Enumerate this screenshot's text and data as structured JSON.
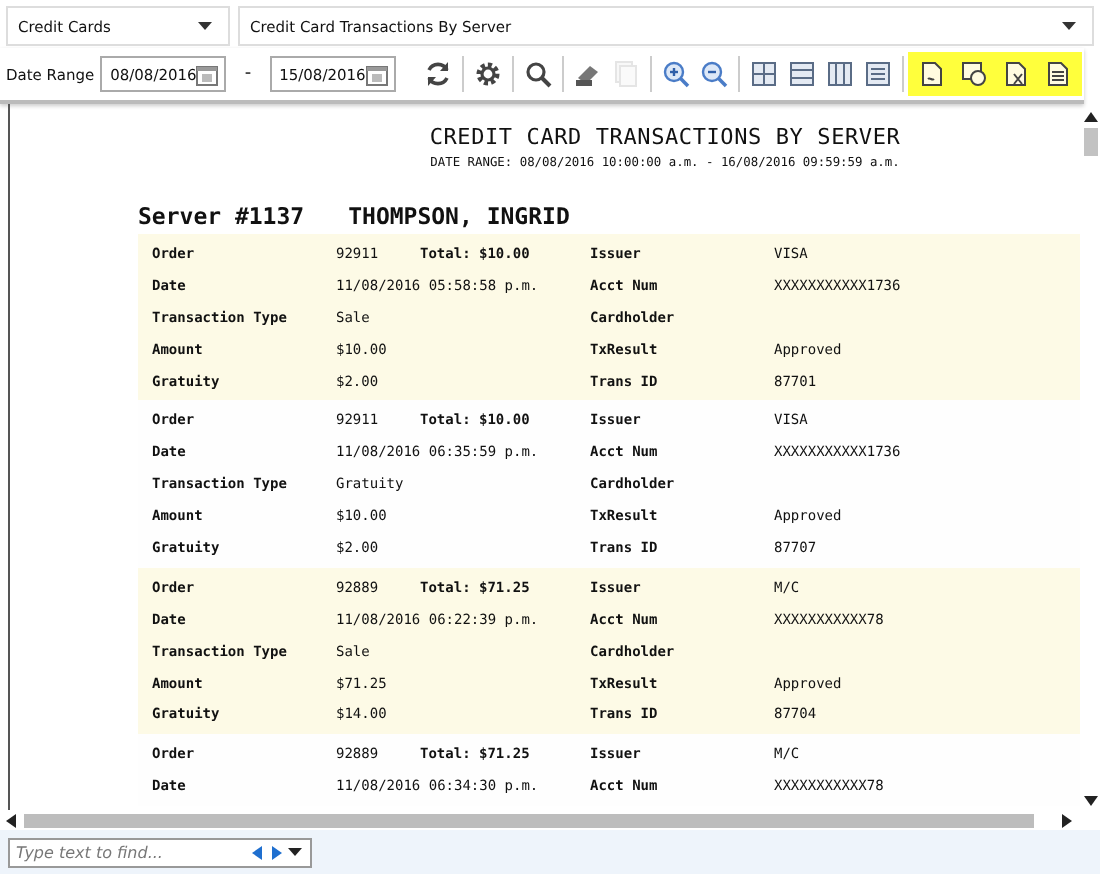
{
  "selectors": [
    {
      "value": "Credit Cards"
    },
    {
      "value": "Credit Card Transactions By Server"
    }
  ],
  "toolbar": {
    "date_range_label": "Date Range",
    "date_from": "08/08/2016",
    "separator": "-",
    "date_to": "15/08/2016",
    "groups": [
      {
        "buttons": [
          {
            "kind": "refresh",
            "disabled": false
          }
        ]
      },
      {
        "buttons": [
          {
            "kind": "settings",
            "disabled": false
          }
        ]
      },
      {
        "buttons": [
          {
            "kind": "find",
            "disabled": false
          }
        ]
      },
      {
        "buttons": [
          {
            "kind": "print",
            "disabled": false
          },
          {
            "kind": "copy",
            "disabled": true
          }
        ]
      },
      {
        "buttons": [
          {
            "kind": "zoom-in",
            "disabled": false
          },
          {
            "kind": "zoom-out",
            "disabled": false
          }
        ]
      },
      {
        "buttons": [
          {
            "kind": "grid",
            "disabled": false
          },
          {
            "kind": "rows",
            "disabled": false
          },
          {
            "kind": "columns",
            "disabled": false
          },
          {
            "kind": "lines",
            "disabled": false
          }
        ]
      }
    ],
    "export_group": {
      "highlighted": true,
      "buttons": [
        {
          "kind": "doc",
          "disabled": false
        },
        {
          "kind": "web",
          "disabled": false
        },
        {
          "kind": "sheet",
          "disabled": false
        },
        {
          "kind": "text",
          "disabled": false
        }
      ]
    }
  },
  "report": {
    "title": "CREDIT CARD TRANSACTIONS BY SERVER",
    "subtitle": "DATE RANGE: 08/08/2016 10:00:00 a.m. - 16/08/2016 09:59:59 a.m.",
    "server_number": "Server #1137",
    "server_name": "THOMPSON, INGRID",
    "records": [
      {
        "shaded": true,
        "rows": [
          {
            "label": "Order",
            "value": "92911",
            "total": "Total: $10.00",
            "label2": "Issuer",
            "value2": "VISA"
          },
          {
            "label": "Date",
            "value": "11/08/2016 05:58:58 p.m.",
            "label2": "Acct Num",
            "value2": "XXXXXXXXXXX1736"
          },
          {
            "label": "Transaction Type",
            "value": "Sale",
            "label2": "Cardholder"
          },
          {
            "label": "Amount",
            "value": "$10.00",
            "label2": "TxResult",
            "value2": "Approved"
          },
          {
            "label": "Gratuity",
            "value": "$2.00",
            "label2": "Trans ID",
            "value2": "87701"
          }
        ]
      },
      {
        "shaded": false,
        "rows": [
          {
            "label": "Order",
            "value": "92911",
            "total": "Total: $10.00",
            "label2": "Issuer",
            "value2": "VISA"
          },
          {
            "label": "Date",
            "value": "11/08/2016 06:35:59 p.m.",
            "label2": "Acct Num",
            "value2": "XXXXXXXXXXX1736"
          },
          {
            "label": "Transaction Type",
            "value": "Gratuity",
            "label2": "Cardholder"
          },
          {
            "label": "Amount",
            "value": "$10.00",
            "label2": "TxResult",
            "value2": "Approved"
          },
          {
            "label": "Gratuity",
            "value": "$2.00",
            "label2": "Trans ID",
            "value2": "87707"
          }
        ]
      },
      {
        "shaded": true,
        "rows": [
          {
            "label": "Order",
            "value": "92889",
            "total": "Total: $71.25",
            "label2": "Issuer",
            "value2": "M/C"
          },
          {
            "label": "Date",
            "value": "11/08/2016 06:22:39 p.m.",
            "label2": "Acct Num",
            "value2": "XXXXXXXXXXX78"
          },
          {
            "label": "Transaction Type",
            "value": "Sale",
            "label2": "Cardholder"
          },
          {
            "label": "Amount",
            "value": "$71.25",
            "label2": "TxResult",
            "value2": "Approved"
          },
          {
            "label": "Gratuity",
            "value": "$14.00",
            "label2": "Trans ID",
            "value2": "87704"
          }
        ]
      },
      {
        "shaded": false,
        "rows": [
          {
            "label": "Order",
            "value": "92889",
            "total": "Total: $71.25",
            "label2": "Issuer",
            "value2": "M/C"
          },
          {
            "label": "Date",
            "value": "11/08/2016 06:34:30 p.m.",
            "label2": "Acct Num",
            "value2": "XXXXXXXXXXX78"
          }
        ]
      }
    ]
  },
  "find": {
    "placeholder": "Type text to find..."
  }
}
